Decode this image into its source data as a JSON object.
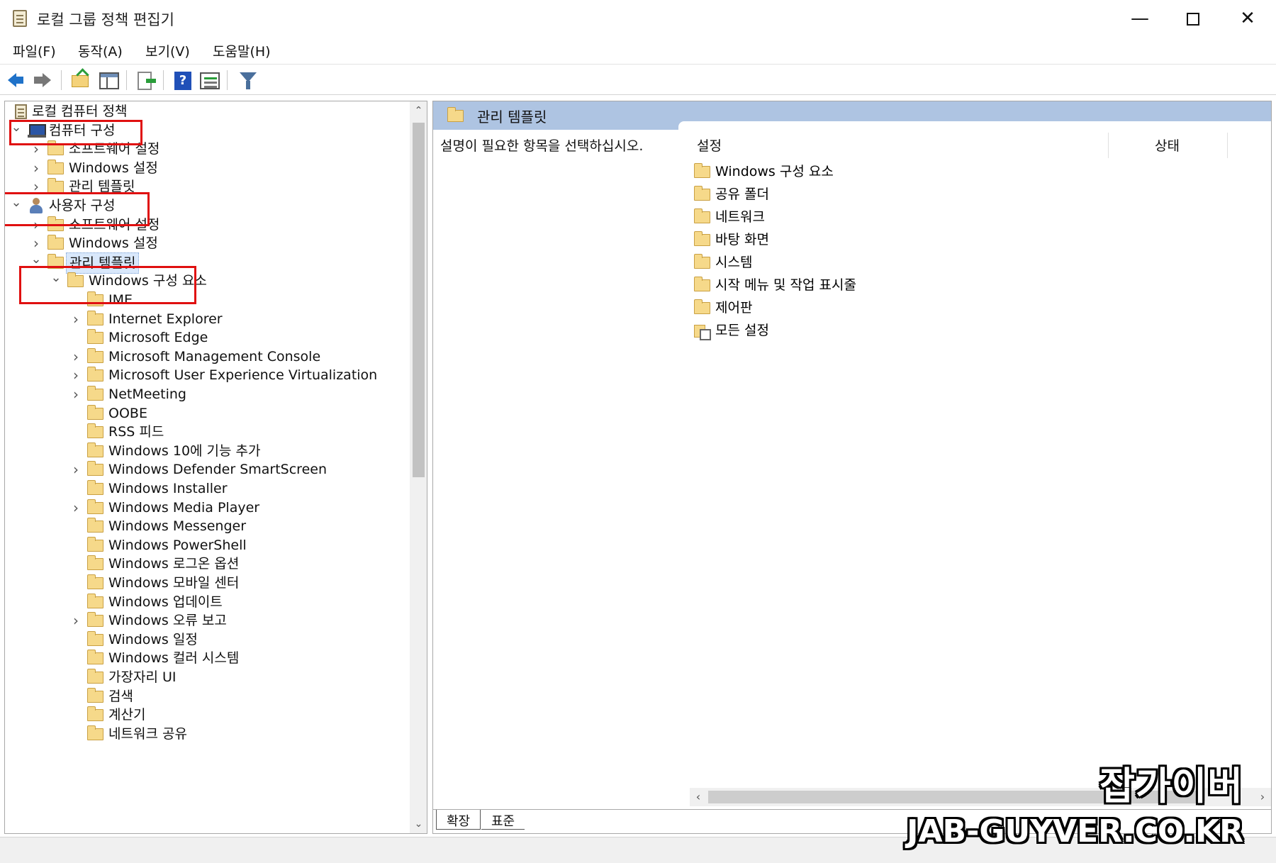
{
  "window": {
    "title": "로컬 그룹 정책 편집기",
    "minimize": "—",
    "close": "✕"
  },
  "menu": [
    "파일(F)",
    "동작(A)",
    "보기(V)",
    "도움말(H)"
  ],
  "tree": [
    {
      "label": "로컬 컴퓨터 정책",
      "icon": "document-icon",
      "level": 0,
      "twisty": ""
    },
    {
      "label": "컴퓨터 구성",
      "icon": "computer-icon",
      "level": 0,
      "twisty": "expanded"
    },
    {
      "label": "소프트웨어 설정",
      "icon": "folder-icon",
      "level": 1,
      "twisty": "collapsed"
    },
    {
      "label": "Windows 설정",
      "icon": "folder-icon",
      "level": 1,
      "twisty": "collapsed"
    },
    {
      "label": "관리 템플릿",
      "icon": "folder-icon",
      "level": 1,
      "twisty": "collapsed"
    },
    {
      "label": "사용자 구성",
      "icon": "user-icon",
      "level": 0,
      "twisty": "expanded"
    },
    {
      "label": "소프트웨어 설정",
      "icon": "folder-icon",
      "level": 1,
      "twisty": "collapsed"
    },
    {
      "label": "Windows 설정",
      "icon": "folder-icon",
      "level": 1,
      "twisty": "collapsed"
    },
    {
      "label": "관리 템플릿",
      "icon": "folder-icon",
      "level": 1,
      "twisty": "expanded",
      "selected": true
    },
    {
      "label": "Windows 구성 요소",
      "icon": "folder-icon",
      "level": 2,
      "twisty": "expanded"
    },
    {
      "label": "IME",
      "icon": "folder-icon",
      "level": 3,
      "twisty": ""
    },
    {
      "label": "Internet Explorer",
      "icon": "folder-icon",
      "level": 3,
      "twisty": "collapsed"
    },
    {
      "label": "Microsoft Edge",
      "icon": "folder-icon",
      "level": 3,
      "twisty": ""
    },
    {
      "label": "Microsoft Management Console",
      "icon": "folder-icon",
      "level": 3,
      "twisty": "collapsed"
    },
    {
      "label": "Microsoft User Experience Virtualization",
      "icon": "folder-icon",
      "level": 3,
      "twisty": "collapsed"
    },
    {
      "label": "NetMeeting",
      "icon": "folder-icon",
      "level": 3,
      "twisty": "collapsed"
    },
    {
      "label": "OOBE",
      "icon": "folder-icon",
      "level": 3,
      "twisty": ""
    },
    {
      "label": "RSS 피드",
      "icon": "folder-icon",
      "level": 3,
      "twisty": ""
    },
    {
      "label": "Windows 10에 기능 추가",
      "icon": "folder-icon",
      "level": 3,
      "twisty": ""
    },
    {
      "label": "Windows Defender SmartScreen",
      "icon": "folder-icon",
      "level": 3,
      "twisty": "collapsed"
    },
    {
      "label": "Windows Installer",
      "icon": "folder-icon",
      "level": 3,
      "twisty": ""
    },
    {
      "label": "Windows Media Player",
      "icon": "folder-icon",
      "level": 3,
      "twisty": "collapsed"
    },
    {
      "label": "Windows Messenger",
      "icon": "folder-icon",
      "level": 3,
      "twisty": ""
    },
    {
      "label": "Windows PowerShell",
      "icon": "folder-icon",
      "level": 3,
      "twisty": ""
    },
    {
      "label": "Windows 로그온 옵션",
      "icon": "folder-icon",
      "level": 3,
      "twisty": ""
    },
    {
      "label": "Windows 모바일 센터",
      "icon": "folder-icon",
      "level": 3,
      "twisty": ""
    },
    {
      "label": "Windows 업데이트",
      "icon": "folder-icon",
      "level": 3,
      "twisty": ""
    },
    {
      "label": "Windows 오류 보고",
      "icon": "folder-icon",
      "level": 3,
      "twisty": "collapsed"
    },
    {
      "label": "Windows 일정",
      "icon": "folder-icon",
      "level": 3,
      "twisty": ""
    },
    {
      "label": "Windows 컬러 시스템",
      "icon": "folder-icon",
      "level": 3,
      "twisty": ""
    },
    {
      "label": "가장자리 UI",
      "icon": "folder-icon",
      "level": 3,
      "twisty": ""
    },
    {
      "label": "검색",
      "icon": "folder-icon",
      "level": 3,
      "twisty": ""
    },
    {
      "label": "계산기",
      "icon": "folder-icon",
      "level": 3,
      "twisty": ""
    },
    {
      "label": "네트워크 공유",
      "icon": "folder-icon",
      "level": 3,
      "twisty": ""
    }
  ],
  "right_pane": {
    "header_title": "관리 템플릿",
    "description": "설명이 필요한 항목을 선택하십시오.",
    "col_setting": "설정",
    "col_status": "상태",
    "items": [
      {
        "label": "Windows 구성 요소",
        "icon": "folder-icon"
      },
      {
        "label": "공유 폴더",
        "icon": "folder-icon"
      },
      {
        "label": "네트워크",
        "icon": "folder-icon"
      },
      {
        "label": "바탕 화면",
        "icon": "folder-icon"
      },
      {
        "label": "시스템",
        "icon": "folder-icon"
      },
      {
        "label": "시작 메뉴 및 작업 표시줄",
        "icon": "folder-icon"
      },
      {
        "label": "제어판",
        "icon": "folder-icon"
      },
      {
        "label": "모든 설정",
        "icon": "settings-icon"
      }
    ]
  },
  "tabs": {
    "extended": "확장",
    "standard": "표준"
  },
  "watermark": {
    "line1": "잡가이버",
    "line2": "JAB-GUYVER.CO.KR"
  },
  "colors": {
    "header_bar": "#aec4e2",
    "highlight": "#e01010",
    "folder": "#f6d98a"
  }
}
